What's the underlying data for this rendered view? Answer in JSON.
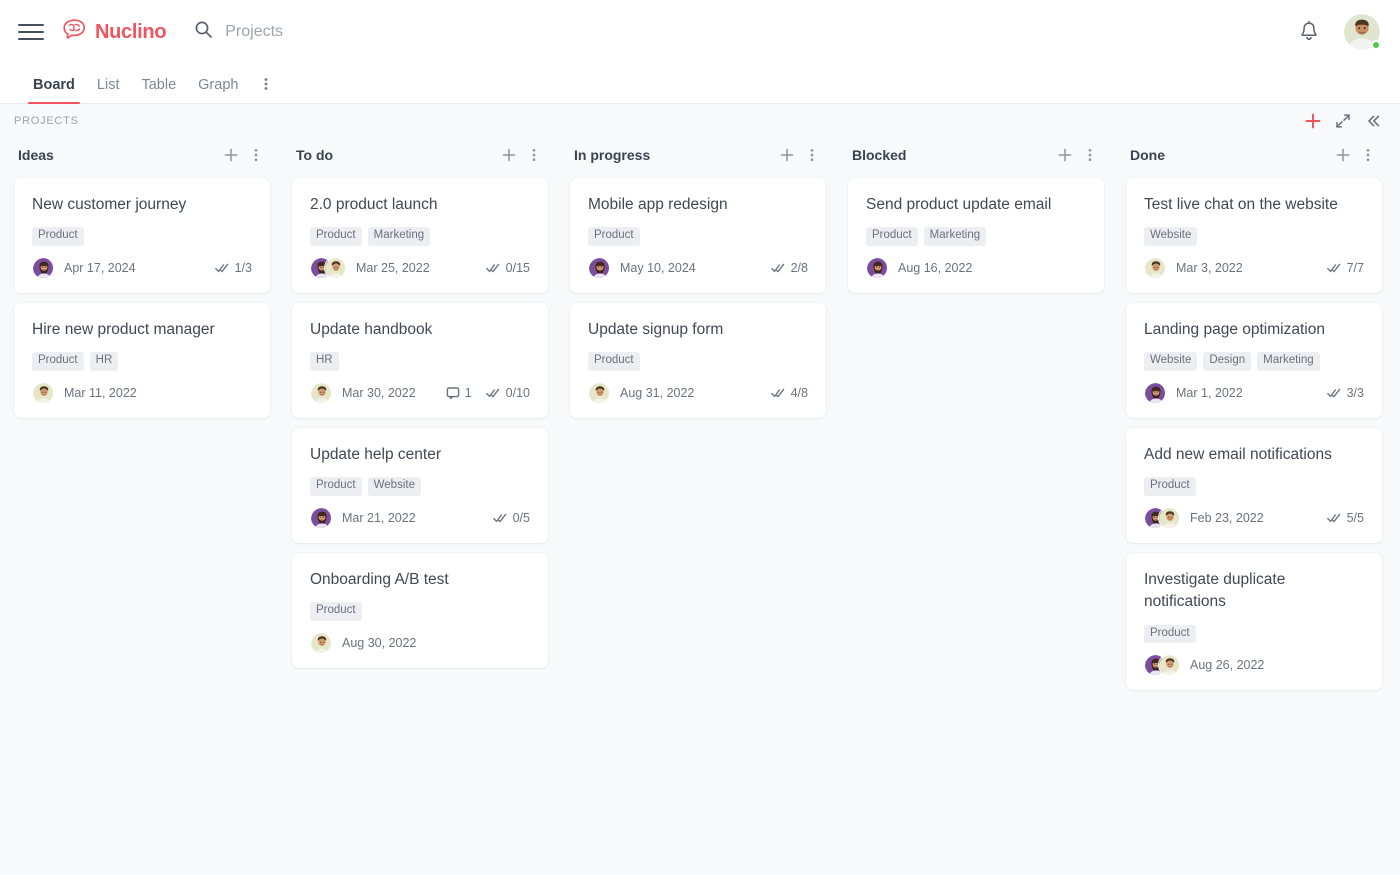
{
  "header": {
    "menu_icon": "hamburger-icon",
    "brand_name": "Nuclino",
    "brand_icon": "brain-logo-icon",
    "search_icon": "search-icon",
    "search_value": "",
    "search_placeholder": "Projects",
    "notifications_icon": "bell-icon",
    "avatar_icon": "user-avatar",
    "status": "online",
    "accent_color": "#f0555f"
  },
  "tabs": [
    {
      "label": "Board",
      "active": true
    },
    {
      "label": "List",
      "active": false
    },
    {
      "label": "Table",
      "active": false
    },
    {
      "label": "Graph",
      "active": false
    }
  ],
  "tabs_more_icon": "more-vertical-icon",
  "board": {
    "label": "PROJECTS",
    "tools": [
      {
        "name": "add-item-button",
        "icon": "plus-icon",
        "color": "#f0555f"
      },
      {
        "name": "collapse-all-button",
        "icon": "collapse-arrows-icon",
        "color": "#69737e"
      },
      {
        "name": "hide-sidebar-button",
        "icon": "chevrons-left-icon",
        "color": "#69737e"
      }
    ]
  },
  "columns": [
    {
      "title": "Ideas",
      "add_icon": "plus-icon",
      "menu_icon": "more-vertical-icon",
      "cards": [
        {
          "title": "New customer journey",
          "tags": [
            "Product"
          ],
          "avatars": [
            "purple"
          ],
          "date": "Apr 17, 2024",
          "tasks": "1/3",
          "comments": null
        },
        {
          "title": "Hire new product manager",
          "tags": [
            "Product",
            "HR"
          ],
          "avatars": [
            "cream"
          ],
          "date": "Mar 11, 2022",
          "tasks": null,
          "comments": null
        }
      ]
    },
    {
      "title": "To do",
      "add_icon": "plus-icon",
      "menu_icon": "more-vertical-icon",
      "cards": [
        {
          "title": "2.0 product launch",
          "tags": [
            "Product",
            "Marketing"
          ],
          "avatars": [
            "purple",
            "cream"
          ],
          "date": "Mar 25, 2022",
          "tasks": "0/15",
          "comments": null
        },
        {
          "title": "Update handbook",
          "tags": [
            "HR"
          ],
          "avatars": [
            "cream"
          ],
          "date": "Mar 30, 2022",
          "tasks": "0/10",
          "comments": "1"
        },
        {
          "title": "Update help center",
          "tags": [
            "Product",
            "Website"
          ],
          "avatars": [
            "purple"
          ],
          "date": "Mar 21, 2022",
          "tasks": "0/5",
          "comments": null
        },
        {
          "title": "Onboarding A/B test",
          "tags": [
            "Product"
          ],
          "avatars": [
            "cream"
          ],
          "date": "Aug 30, 2022",
          "tasks": null,
          "comments": null
        }
      ]
    },
    {
      "title": "In progress",
      "add_icon": "plus-icon",
      "menu_icon": "more-vertical-icon",
      "cards": [
        {
          "title": "Mobile app redesign",
          "tags": [
            "Product"
          ],
          "avatars": [
            "purple"
          ],
          "date": "May 10, 2024",
          "tasks": "2/8",
          "comments": null
        },
        {
          "title": "Update signup form",
          "tags": [
            "Product"
          ],
          "avatars": [
            "cream"
          ],
          "date": "Aug 31, 2022",
          "tasks": "4/8",
          "comments": null
        }
      ]
    },
    {
      "title": "Blocked",
      "add_icon": "plus-icon",
      "menu_icon": "more-vertical-icon",
      "cards": [
        {
          "title": "Send product update email",
          "tags": [
            "Product",
            "Marketing"
          ],
          "avatars": [
            "purple"
          ],
          "date": "Aug 16, 2022",
          "tasks": null,
          "comments": null
        }
      ]
    },
    {
      "title": "Done",
      "add_icon": "plus-icon",
      "menu_icon": "more-vertical-icon",
      "cards": [
        {
          "title": "Test live chat on the website",
          "tags": [
            "Website"
          ],
          "avatars": [
            "cream"
          ],
          "date": "Mar 3, 2022",
          "tasks": "7/7",
          "comments": null
        },
        {
          "title": "Landing page optimization",
          "tags": [
            "Website",
            "Design",
            "Marketing"
          ],
          "avatars": [
            "purple"
          ],
          "date": "Mar 1, 2022",
          "tasks": "3/3",
          "comments": null
        },
        {
          "title": "Add new email notifications",
          "tags": [
            "Product"
          ],
          "avatars": [
            "purple",
            "cream"
          ],
          "date": "Feb 23, 2022",
          "tasks": "5/5",
          "comments": null
        },
        {
          "title": "Investigate duplicate notifications",
          "tags": [
            "Product"
          ],
          "avatars": [
            "purple",
            "cream"
          ],
          "date": "Aug 26, 2022",
          "tasks": null,
          "comments": null
        }
      ]
    }
  ]
}
